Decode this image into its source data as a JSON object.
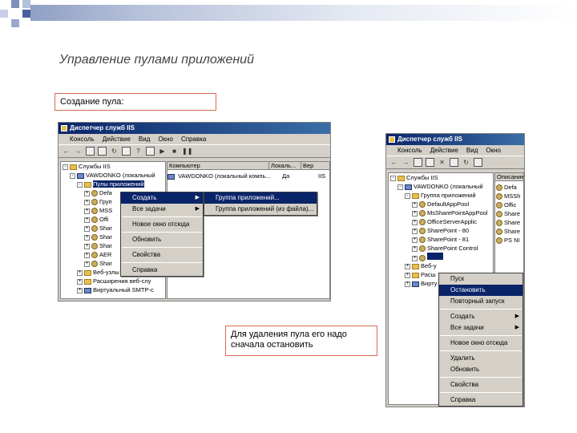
{
  "slide": {
    "title": "Управление пулами приложений",
    "create_note": "Создание пула:",
    "delete_note": "Для удаления пула его надо сначала остановить"
  },
  "left_window": {
    "title": "Диспетчер служб IIS",
    "menu": [
      "Консоль",
      "Действие",
      "Вид",
      "Окно",
      "Справка"
    ],
    "columns": [
      "Компьютер",
      "Локаль...",
      "Вер"
    ],
    "list_row": [
      "VAWDONKO (локальный компь...",
      "Да",
      "IIS"
    ],
    "tree": [
      {
        "label": "Службы IIS",
        "icon": "folder",
        "level": 0,
        "exp": "-"
      },
      {
        "label": "VAWDONKO (локальный",
        "icon": "pc",
        "level": 1,
        "exp": "-"
      },
      {
        "label": "Пулы приложений",
        "icon": "folder",
        "level": 2,
        "exp": "-",
        "selected": true
      },
      {
        "label": "Defa",
        "icon": "gear",
        "level": 3,
        "exp": "+"
      },
      {
        "label": "Груп",
        "icon": "gear",
        "level": 3,
        "exp": "+"
      },
      {
        "label": "MSS",
        "icon": "gear",
        "level": 3,
        "exp": "+"
      },
      {
        "label": "Offi",
        "icon": "gear",
        "level": 3,
        "exp": "+"
      },
      {
        "label": "Shar",
        "icon": "gear",
        "level": 3,
        "exp": "+"
      },
      {
        "label": "Shar",
        "icon": "gear",
        "level": 3,
        "exp": "+"
      },
      {
        "label": "Shar",
        "icon": "gear",
        "level": 3,
        "exp": "+"
      },
      {
        "label": "AER",
        "icon": "gear",
        "level": 3,
        "exp": "+"
      },
      {
        "label": "Shar",
        "icon": "gear",
        "level": 3,
        "exp": "+"
      },
      {
        "label": "Веб-узлы",
        "icon": "folder",
        "level": 2,
        "exp": "+"
      },
      {
        "label": "Расширения веб-слу",
        "icon": "folder",
        "level": 2,
        "exp": "+"
      },
      {
        "label": "Виртуальный SMTP-с",
        "icon": "pc",
        "level": 2,
        "exp": "+"
      }
    ],
    "context_menu": [
      "Создать",
      "Все задачи",
      "---",
      "Новое окно отсюда",
      "---",
      "Обновить",
      "---",
      "Свойства",
      "---",
      "Справка"
    ],
    "submenu": [
      "Группа приложений...",
      "Группа приложений (из файла)..."
    ]
  },
  "right_window": {
    "title": "Диспетчер служб IIS",
    "menu": [
      "Консоль",
      "Действие",
      "Вид",
      "Окно"
    ],
    "columns": [
      "Описание"
    ],
    "tree": [
      {
        "label": "Службы IIS",
        "icon": "folder",
        "level": 0,
        "exp": "-"
      },
      {
        "label": "VAWDONKO (локальный",
        "icon": "pc",
        "level": 1,
        "exp": "-"
      },
      {
        "label": "Группа приложений",
        "icon": "folder",
        "level": 2,
        "exp": "-"
      },
      {
        "label": "DefaultAppPool",
        "icon": "gear",
        "level": 3,
        "exp": "+"
      },
      {
        "label": "MsSharePointAppPool",
        "icon": "gear",
        "level": 3,
        "exp": "+"
      },
      {
        "label": "OfficeServerApplic",
        "icon": "gear",
        "level": 3,
        "exp": "+"
      },
      {
        "label": "SharePoint - 80",
        "icon": "gear",
        "level": 3,
        "exp": "+"
      },
      {
        "label": "SharePoint - 81",
        "icon": "gear",
        "level": 3,
        "exp": "+"
      },
      {
        "label": "SharePoint Control",
        "icon": "gear",
        "level": 3,
        "exp": "+"
      },
      {
        "label": "",
        "icon": "gear",
        "level": 3,
        "exp": "+",
        "selected": true
      },
      {
        "label": "Веб-у",
        "icon": "folder",
        "level": 2,
        "exp": "+"
      },
      {
        "label": "Расш",
        "icon": "folder",
        "level": 2,
        "exp": "+"
      },
      {
        "label": "Вирту",
        "icon": "pc",
        "level": 2,
        "exp": "+"
      }
    ],
    "list_items": [
      "Defa",
      "MSSh",
      "Offic",
      "Share",
      "Share",
      "Share",
      "PS NI"
    ],
    "context_menu": [
      "Пуск",
      "Остановить",
      "Повторный запуск",
      "---",
      "Создать",
      "Все задачи",
      "---",
      "Новое окно отсюда",
      "---",
      "Удалить",
      "Обновить",
      "---",
      "Свойства",
      "---",
      "Справка"
    ]
  },
  "colors": {
    "title_bar": "#0a246a",
    "selection": "#0a246a",
    "note_border": "#d86b55",
    "window_face": "#d4d0c8"
  }
}
